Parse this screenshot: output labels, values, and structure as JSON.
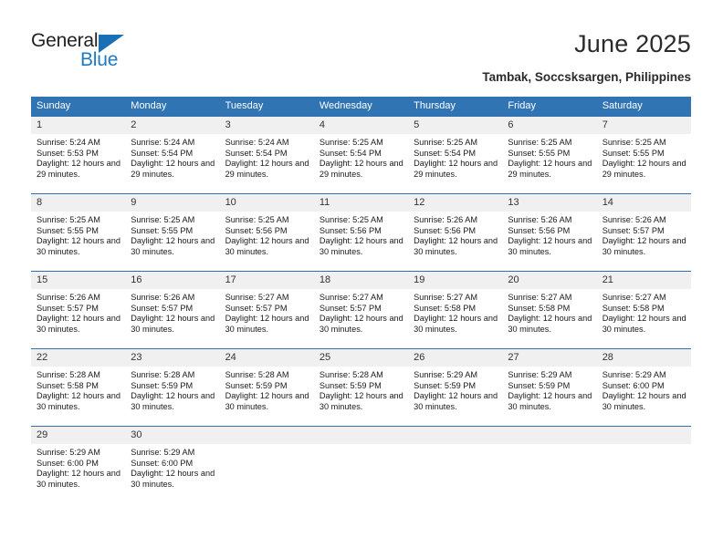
{
  "brand": {
    "line1": "General",
    "line2": "Blue",
    "accent_color": "#1b6fb5"
  },
  "header": {
    "title": "June 2025",
    "location": "Tambak, Soccsksargen, Philippines"
  },
  "calendar": {
    "header_bg": "#3074b4",
    "daynum_bg": "#f0f0f0",
    "weekdays": [
      "Sunday",
      "Monday",
      "Tuesday",
      "Wednesday",
      "Thursday",
      "Friday",
      "Saturday"
    ],
    "labels": {
      "sunrise": "Sunrise:",
      "sunset": "Sunset:",
      "daylight": "Daylight:"
    },
    "weeks": [
      [
        {
          "day": "1",
          "sunrise": "Sunrise: 5:24 AM",
          "sunset": "Sunset: 5:53 PM",
          "daylight": "Daylight: 12 hours and 29 minutes."
        },
        {
          "day": "2",
          "sunrise": "Sunrise: 5:24 AM",
          "sunset": "Sunset: 5:54 PM",
          "daylight": "Daylight: 12 hours and 29 minutes."
        },
        {
          "day": "3",
          "sunrise": "Sunrise: 5:24 AM",
          "sunset": "Sunset: 5:54 PM",
          "daylight": "Daylight: 12 hours and 29 minutes."
        },
        {
          "day": "4",
          "sunrise": "Sunrise: 5:25 AM",
          "sunset": "Sunset: 5:54 PM",
          "daylight": "Daylight: 12 hours and 29 minutes."
        },
        {
          "day": "5",
          "sunrise": "Sunrise: 5:25 AM",
          "sunset": "Sunset: 5:54 PM",
          "daylight": "Daylight: 12 hours and 29 minutes."
        },
        {
          "day": "6",
          "sunrise": "Sunrise: 5:25 AM",
          "sunset": "Sunset: 5:55 PM",
          "daylight": "Daylight: 12 hours and 29 minutes."
        },
        {
          "day": "7",
          "sunrise": "Sunrise: 5:25 AM",
          "sunset": "Sunset: 5:55 PM",
          "daylight": "Daylight: 12 hours and 29 minutes."
        }
      ],
      [
        {
          "day": "8",
          "sunrise": "Sunrise: 5:25 AM",
          "sunset": "Sunset: 5:55 PM",
          "daylight": "Daylight: 12 hours and 30 minutes."
        },
        {
          "day": "9",
          "sunrise": "Sunrise: 5:25 AM",
          "sunset": "Sunset: 5:55 PM",
          "daylight": "Daylight: 12 hours and 30 minutes."
        },
        {
          "day": "10",
          "sunrise": "Sunrise: 5:25 AM",
          "sunset": "Sunset: 5:56 PM",
          "daylight": "Daylight: 12 hours and 30 minutes."
        },
        {
          "day": "11",
          "sunrise": "Sunrise: 5:25 AM",
          "sunset": "Sunset: 5:56 PM",
          "daylight": "Daylight: 12 hours and 30 minutes."
        },
        {
          "day": "12",
          "sunrise": "Sunrise: 5:26 AM",
          "sunset": "Sunset: 5:56 PM",
          "daylight": "Daylight: 12 hours and 30 minutes."
        },
        {
          "day": "13",
          "sunrise": "Sunrise: 5:26 AM",
          "sunset": "Sunset: 5:56 PM",
          "daylight": "Daylight: 12 hours and 30 minutes."
        },
        {
          "day": "14",
          "sunrise": "Sunrise: 5:26 AM",
          "sunset": "Sunset: 5:57 PM",
          "daylight": "Daylight: 12 hours and 30 minutes."
        }
      ],
      [
        {
          "day": "15",
          "sunrise": "Sunrise: 5:26 AM",
          "sunset": "Sunset: 5:57 PM",
          "daylight": "Daylight: 12 hours and 30 minutes."
        },
        {
          "day": "16",
          "sunrise": "Sunrise: 5:26 AM",
          "sunset": "Sunset: 5:57 PM",
          "daylight": "Daylight: 12 hours and 30 minutes."
        },
        {
          "day": "17",
          "sunrise": "Sunrise: 5:27 AM",
          "sunset": "Sunset: 5:57 PM",
          "daylight": "Daylight: 12 hours and 30 minutes."
        },
        {
          "day": "18",
          "sunrise": "Sunrise: 5:27 AM",
          "sunset": "Sunset: 5:57 PM",
          "daylight": "Daylight: 12 hours and 30 minutes."
        },
        {
          "day": "19",
          "sunrise": "Sunrise: 5:27 AM",
          "sunset": "Sunset: 5:58 PM",
          "daylight": "Daylight: 12 hours and 30 minutes."
        },
        {
          "day": "20",
          "sunrise": "Sunrise: 5:27 AM",
          "sunset": "Sunset: 5:58 PM",
          "daylight": "Daylight: 12 hours and 30 minutes."
        },
        {
          "day": "21",
          "sunrise": "Sunrise: 5:27 AM",
          "sunset": "Sunset: 5:58 PM",
          "daylight": "Daylight: 12 hours and 30 minutes."
        }
      ],
      [
        {
          "day": "22",
          "sunrise": "Sunrise: 5:28 AM",
          "sunset": "Sunset: 5:58 PM",
          "daylight": "Daylight: 12 hours and 30 minutes."
        },
        {
          "day": "23",
          "sunrise": "Sunrise: 5:28 AM",
          "sunset": "Sunset: 5:59 PM",
          "daylight": "Daylight: 12 hours and 30 minutes."
        },
        {
          "day": "24",
          "sunrise": "Sunrise: 5:28 AM",
          "sunset": "Sunset: 5:59 PM",
          "daylight": "Daylight: 12 hours and 30 minutes."
        },
        {
          "day": "25",
          "sunrise": "Sunrise: 5:28 AM",
          "sunset": "Sunset: 5:59 PM",
          "daylight": "Daylight: 12 hours and 30 minutes."
        },
        {
          "day": "26",
          "sunrise": "Sunrise: 5:29 AM",
          "sunset": "Sunset: 5:59 PM",
          "daylight": "Daylight: 12 hours and 30 minutes."
        },
        {
          "day": "27",
          "sunrise": "Sunrise: 5:29 AM",
          "sunset": "Sunset: 5:59 PM",
          "daylight": "Daylight: 12 hours and 30 minutes."
        },
        {
          "day": "28",
          "sunrise": "Sunrise: 5:29 AM",
          "sunset": "Sunset: 6:00 PM",
          "daylight": "Daylight: 12 hours and 30 minutes."
        }
      ],
      [
        {
          "day": "29",
          "sunrise": "Sunrise: 5:29 AM",
          "sunset": "Sunset: 6:00 PM",
          "daylight": "Daylight: 12 hours and 30 minutes."
        },
        {
          "day": "30",
          "sunrise": "Sunrise: 5:29 AM",
          "sunset": "Sunset: 6:00 PM",
          "daylight": "Daylight: 12 hours and 30 minutes."
        },
        {
          "day": "",
          "sunrise": "",
          "sunset": "",
          "daylight": "",
          "blank": true
        },
        {
          "day": "",
          "sunrise": "",
          "sunset": "",
          "daylight": "",
          "blank": true
        },
        {
          "day": "",
          "sunrise": "",
          "sunset": "",
          "daylight": "",
          "blank": true
        },
        {
          "day": "",
          "sunrise": "",
          "sunset": "",
          "daylight": "",
          "blank": true
        },
        {
          "day": "",
          "sunrise": "",
          "sunset": "",
          "daylight": "",
          "blank": true
        }
      ]
    ]
  }
}
